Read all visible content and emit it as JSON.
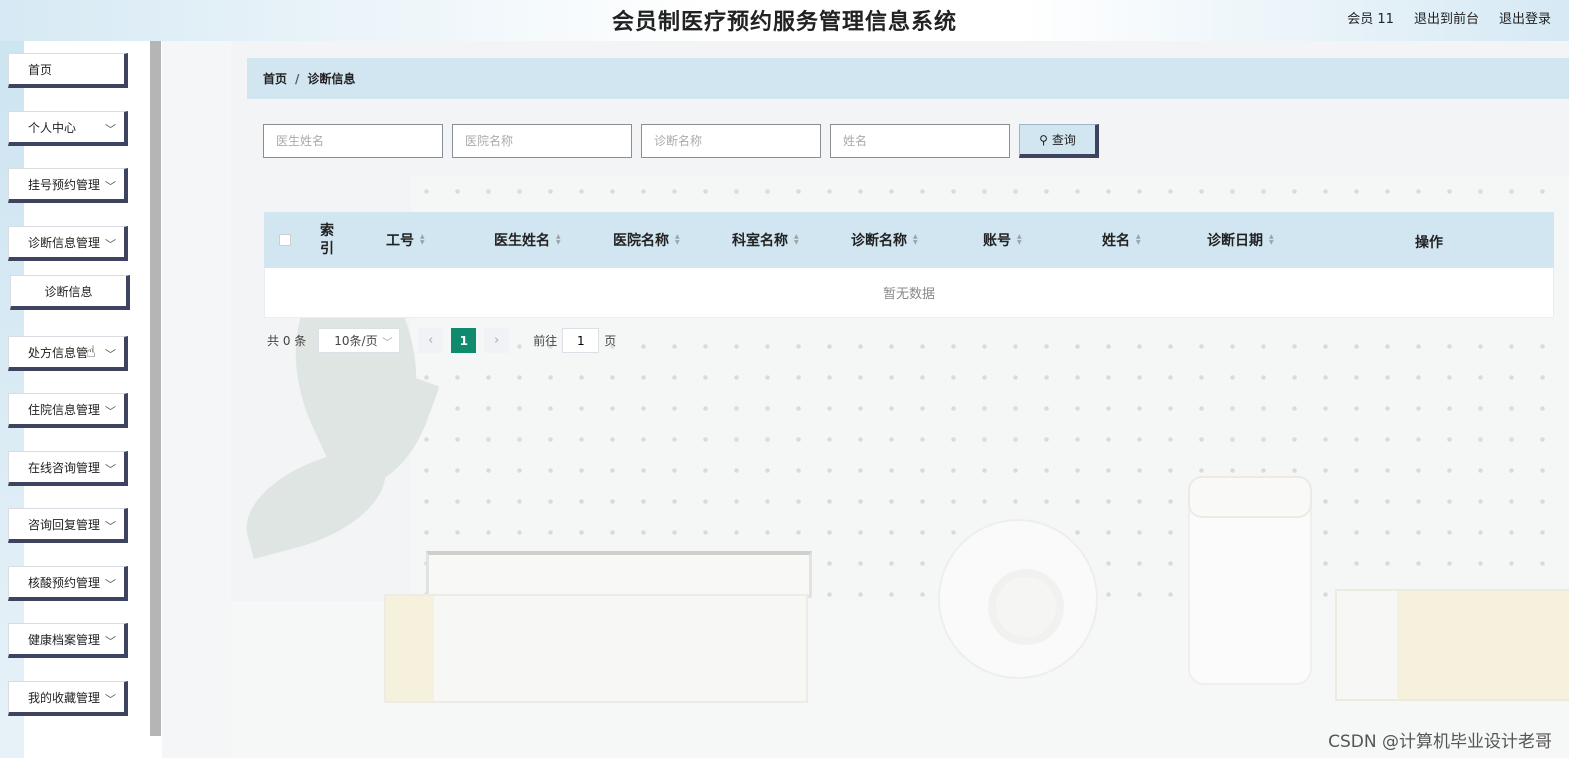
{
  "header": {
    "title": "会员制医疗预约服务管理信息系统",
    "user": "会员 11",
    "back_to_front": "退出到前台",
    "logout": "退出登录"
  },
  "sidebar": {
    "items": [
      {
        "label": "首页"
      },
      {
        "label": "个人中心"
      },
      {
        "label": "挂号预约管理"
      },
      {
        "label": "诊断信息管理"
      },
      {
        "label": "诊断信息"
      },
      {
        "label": "处方信息管"
      },
      {
        "label": "住院信息管理"
      },
      {
        "label": "在线咨询管理"
      },
      {
        "label": "咨询回复管理"
      },
      {
        "label": "核酸预约管理"
      },
      {
        "label": "健康档案管理"
      },
      {
        "label": "我的收藏管理"
      }
    ]
  },
  "breadcrumb": {
    "home": "首页",
    "separator": "/",
    "current": "诊断信息"
  },
  "search": {
    "doctor_placeholder": "医生姓名",
    "hospital_placeholder": "医院名称",
    "diagnosis_placeholder": "诊断名称",
    "name_placeholder": "姓名",
    "button_label": "查询"
  },
  "table": {
    "columns": [
      "索引",
      "工号",
      "医生姓名",
      "医院名称",
      "科室名称",
      "诊断名称",
      "账号",
      "姓名",
      "诊断日期",
      "操作"
    ],
    "empty_text": "暂无数据"
  },
  "pagination": {
    "total": "共 0 条",
    "page_size": "10条/页",
    "current_page": "1",
    "goto_prefix": "前往",
    "goto_value": "1",
    "goto_suffix": "页"
  },
  "watermark": "CSDN @计算机毕业设计老哥",
  "colors": {
    "accent": "#d2e6f2",
    "active_page": "#108a6c",
    "border_dark": "#3e4460"
  }
}
